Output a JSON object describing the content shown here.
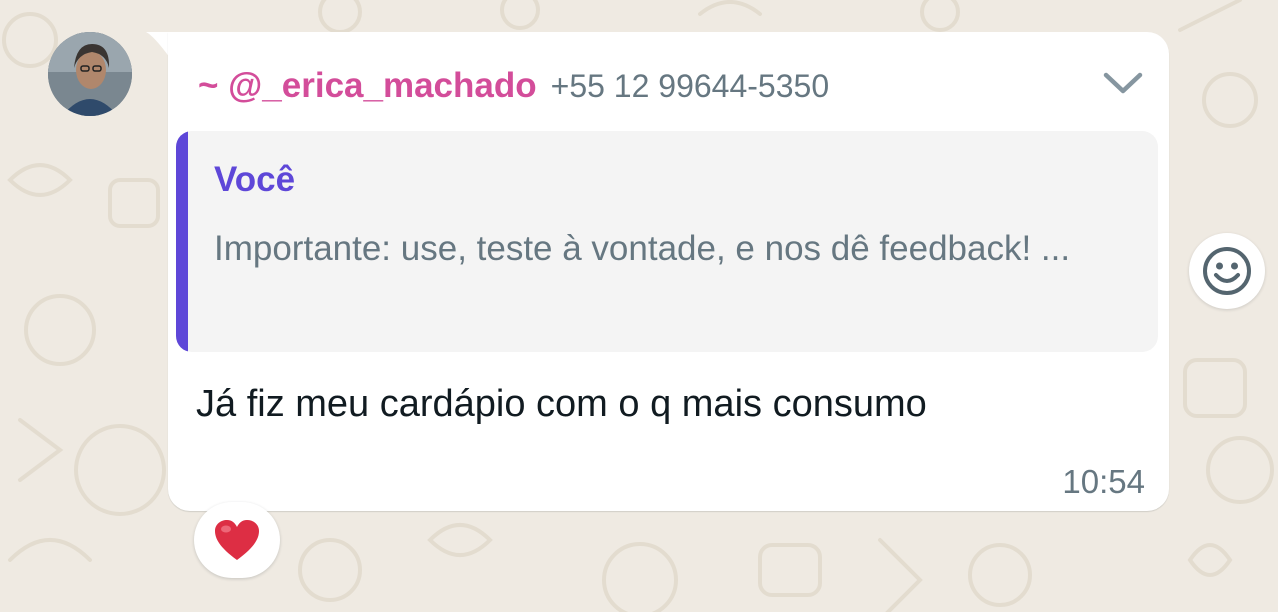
{
  "message": {
    "sender_name": "~ @_erica_machado",
    "sender_phone": "+55 12 99644-5350",
    "quoted": {
      "author": "Você",
      "text": "Importante: use, teste à vontade, e nos dê feedback! ..."
    },
    "text": "Já fiz meu cardápio com o q mais consumo",
    "time": "10:54",
    "reaction": "❤️"
  },
  "colors": {
    "sender": "#d34d9a",
    "quote_accent": "#5e47d8",
    "chat_background": "#efeae2",
    "bubble": "#ffffff",
    "reaction_heart": "#dd2e44"
  },
  "icons": {
    "menu": "chevron-down-icon",
    "react": "emoji-smiley-icon",
    "reaction": "heart-icon"
  }
}
